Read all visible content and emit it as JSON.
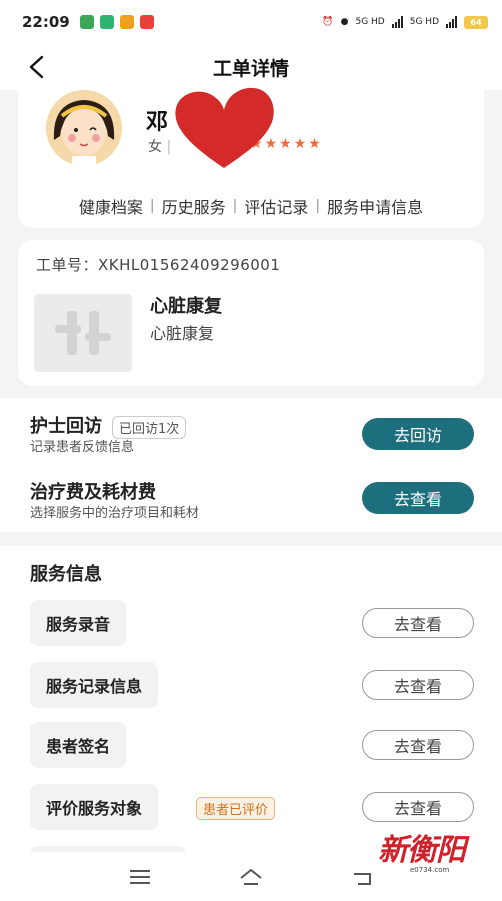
{
  "status_bar": {
    "time": "22:09",
    "network1": "5G HD",
    "network2": "5G HD",
    "battery": "64"
  },
  "header": {
    "title": "工单详情"
  },
  "profile": {
    "name_visible": "邓",
    "gender": "女",
    "separator": "|",
    "stars": 5,
    "tabs": [
      "健康档案",
      "历史服务",
      "评估记录",
      "服务申请信息"
    ]
  },
  "order": {
    "number_label": "工单号：",
    "number": "XKHL01562409296001",
    "service_name": "心脏康复",
    "service_sub": "心脏康复"
  },
  "followup": {
    "title": "护士回访",
    "tag": "已回访1次",
    "subtitle": "记录患者反馈信息",
    "button": "去回访"
  },
  "treatment": {
    "title": "治疗费及耗材费",
    "subtitle": "选择服务中的治疗项目和耗材",
    "button": "去查看"
  },
  "service_info": {
    "title": "服务信息",
    "rows": [
      {
        "label": "服务录音",
        "button": "去查看"
      },
      {
        "label": "服务记录信息",
        "button": "去查看"
      },
      {
        "label": "患者签名",
        "button": "去查看"
      },
      {
        "label": "评价服务对象",
        "tag": "患者已评价",
        "button": "去查看"
      }
    ]
  },
  "watermark": {
    "text": "新衡阳",
    "sub": "e0734.com"
  },
  "colors": {
    "accent": "#1d6f7e",
    "star": "#f06a3a",
    "tag_orange": "#c9741d",
    "heart": "#d42a2a",
    "watermark": "#d0202a"
  }
}
